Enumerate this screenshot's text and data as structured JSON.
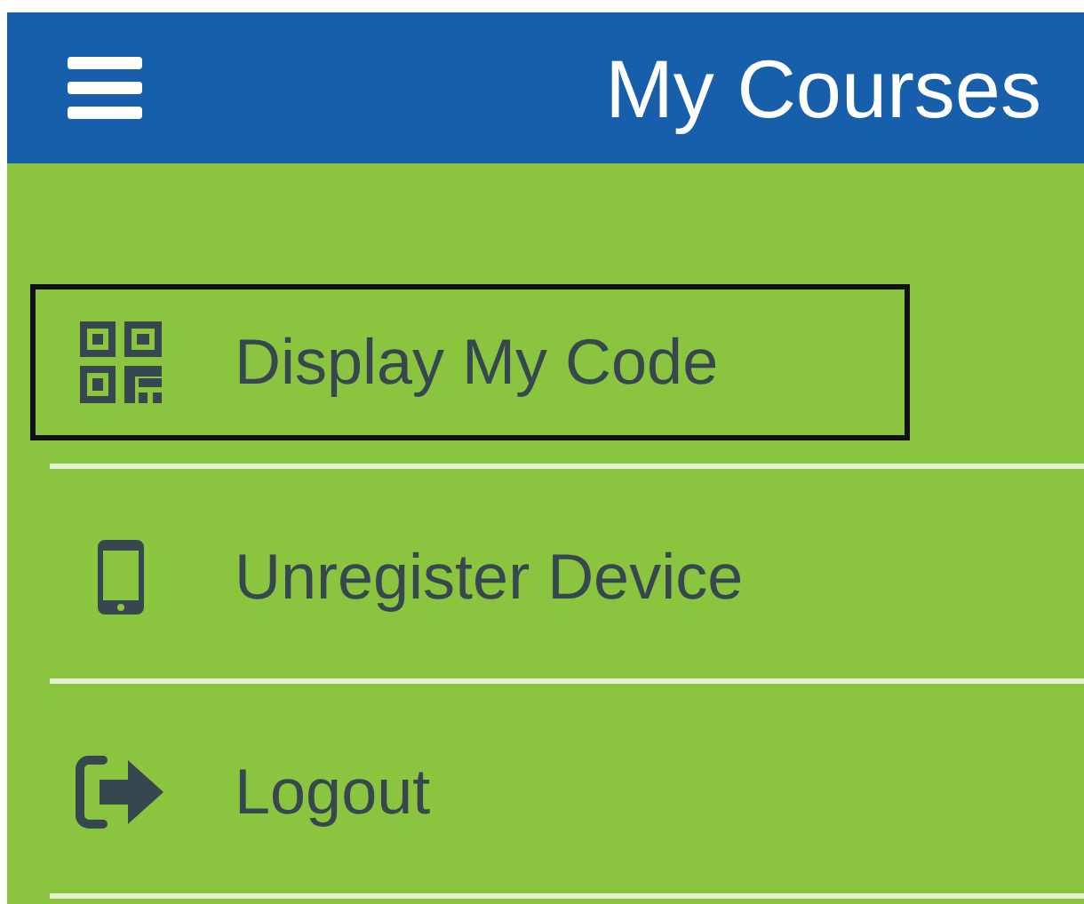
{
  "header": {
    "title": "My Courses"
  },
  "menu": [
    {
      "label": "Display My Code",
      "selected": true
    },
    {
      "label": "Unregister Device",
      "selected": false
    },
    {
      "label": "Logout",
      "selected": false
    }
  ]
}
